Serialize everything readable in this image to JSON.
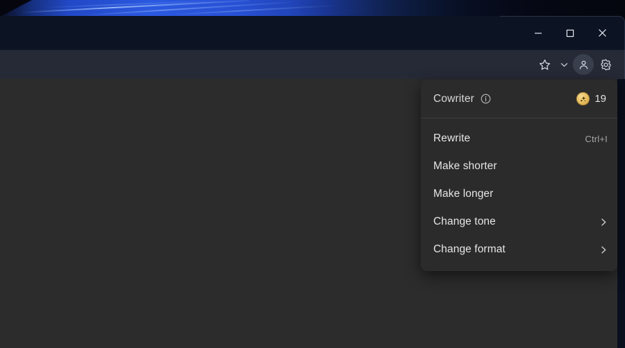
{
  "window": {
    "controls": [
      {
        "name": "minimize",
        "label": "Minimize",
        "glyph": "minimize-icon"
      },
      {
        "name": "maximize",
        "label": "Maximize",
        "glyph": "maximize-icon"
      },
      {
        "name": "close",
        "label": "Close",
        "glyph": "close-icon"
      }
    ]
  },
  "toolbar": {
    "favorites_label": "Favorites",
    "favorites_icon": "star-icon",
    "collections_icon": "chevron-down-icon",
    "profile_label": "Profile",
    "profile_icon": "person-icon",
    "settings_label": "Settings and more",
    "settings_icon": "gear-icon"
  },
  "cowriter_menu": {
    "title": "Cowriter",
    "info_icon": "info-icon",
    "credits": {
      "icon": "coin-icon",
      "count": "19"
    },
    "items": [
      {
        "label": "Rewrite",
        "shortcut": "Ctrl+I",
        "submenu": false
      },
      {
        "label": "Make shorter",
        "shortcut": "",
        "submenu": false
      },
      {
        "label": "Make longer",
        "shortcut": "",
        "submenu": false
      },
      {
        "label": "Change tone",
        "shortcut": "",
        "submenu": true
      },
      {
        "label": "Change format",
        "shortcut": "",
        "submenu": true
      }
    ]
  },
  "colors": {
    "menu_background": "#2b2b2b",
    "page_background": "#2c2c2c",
    "title_bar": "#0c1323",
    "toolbar": "#262a36",
    "coin_gold": "#e7bf62",
    "accent_blue": "#2b59e0"
  }
}
